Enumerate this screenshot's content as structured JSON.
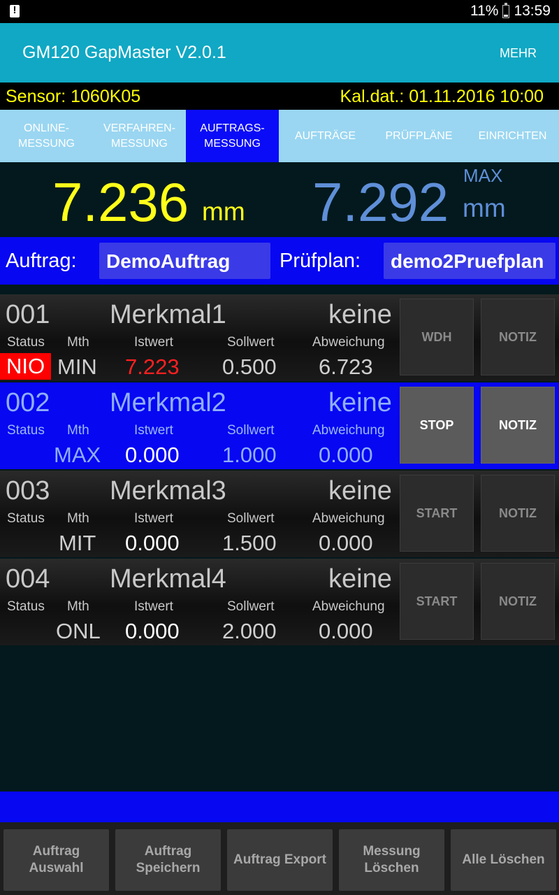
{
  "statusbar": {
    "battery": "11%",
    "time": "13:59"
  },
  "appbar": {
    "title": "GM120 GapMaster V2.0.1",
    "more": "MEHR"
  },
  "info": {
    "sensor": "Sensor: 1060K05",
    "kal": "Kal.dat.: 01.11.2016 10:00"
  },
  "tabs": [
    {
      "label": "ONLINE-\nMESSUNG"
    },
    {
      "label": "VERFAHREN-\nMESSUNG"
    },
    {
      "label": "AUFTRAGS-\nMESSUNG"
    },
    {
      "label": "AUFTRÄGE"
    },
    {
      "label": "PRÜFPLÄNE"
    },
    {
      "label": "EINRICHTEN"
    }
  ],
  "measurement": {
    "current": "7.236",
    "current_unit": "mm",
    "max": "7.292",
    "max_label": "MAX",
    "max_unit": "mm"
  },
  "order": {
    "auftrag_label": "Auftrag:",
    "auftrag_value": "DemoAuftrag",
    "pruefplan_label": "Prüfplan:",
    "pruefplan_value": "demo2Pruefplan"
  },
  "headers": {
    "status": "Status",
    "mth": "Mth",
    "istwert": "Istwert",
    "sollwert": "Sollwert",
    "abweichung": "Abweichung"
  },
  "rows": [
    {
      "num": "001",
      "name": "Merkmal1",
      "kein": "keine",
      "status": "NIO",
      "mth": "MIN",
      "istwert": "7.223",
      "sollwert": "0.500",
      "abweichung": "6.723",
      "btn1": "WDH",
      "btn2": "NOTIZ"
    },
    {
      "num": "002",
      "name": "Merkmal2",
      "kein": "keine",
      "status": "",
      "mth": "MAX",
      "istwert": "0.000",
      "sollwert": "1.000",
      "abweichung": "0.000",
      "btn1": "STOP",
      "btn2": "NOTIZ"
    },
    {
      "num": "003",
      "name": "Merkmal3",
      "kein": "keine",
      "status": "",
      "mth": "MIT",
      "istwert": "0.000",
      "sollwert": "1.500",
      "abweichung": "0.000",
      "btn1": "START",
      "btn2": "NOTIZ"
    },
    {
      "num": "004",
      "name": "Merkmal4",
      "kein": "keine",
      "status": "",
      "mth": "ONL",
      "istwert": "0.000",
      "sollwert": "2.000",
      "abweichung": "0.000",
      "btn1": "START",
      "btn2": "NOTIZ"
    }
  ],
  "bottom": [
    {
      "label": "Auftrag\nAuswahl"
    },
    {
      "label": "Auftrag\nSpeichern"
    },
    {
      "label": "Auftrag Export"
    },
    {
      "label": "Messung\nLöschen"
    },
    {
      "label": "Alle Löschen"
    }
  ],
  "colors": {
    "nio": "#ff0000",
    "ist_nio": "#ff2020",
    "active_row": "#0707f2",
    "accent": "#10a8c4",
    "yellow": "#ffff1a",
    "max_blue": "#5f8fd8"
  }
}
